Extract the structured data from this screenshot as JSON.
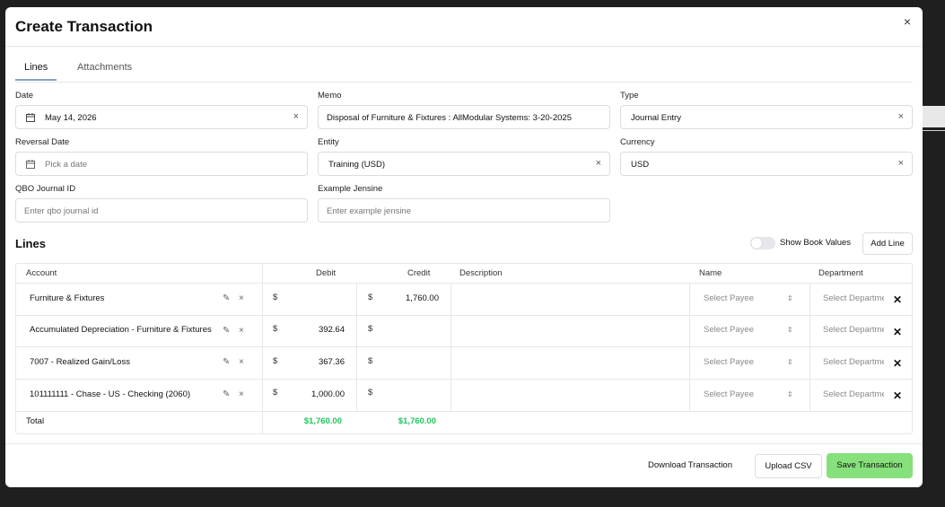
{
  "dialog": {
    "title": "Create Transaction",
    "close_glyph": "×"
  },
  "tabs": [
    {
      "label": "Lines",
      "active": true
    },
    {
      "label": "Attachments",
      "active": false
    }
  ],
  "form": {
    "date": {
      "label": "Date",
      "value": "May 14, 2026"
    },
    "memo": {
      "label": "Memo",
      "value": "Disposal of Furniture & Fixtures : AllModular Systems:  3-20-2025"
    },
    "type": {
      "label": "Type",
      "value": "Journal Entry"
    },
    "reversal_date": {
      "label": "Reversal Date",
      "placeholder": "Pick a date"
    },
    "entity": {
      "label": "Entity",
      "value": "Training (USD)"
    },
    "currency": {
      "label": "Currency",
      "value": "USD"
    },
    "qbo_journal_id": {
      "label": "QBO Journal ID",
      "placeholder": "Enter qbo journal id"
    },
    "example_jensine": {
      "label": "Example Jensine",
      "placeholder": "Enter example jensine"
    }
  },
  "lines_section": {
    "title": "Lines",
    "show_book_values_label": "Show Book Values",
    "show_book_values_on": false,
    "add_line_label": "Add Line"
  },
  "table": {
    "columns": {
      "account": "Account",
      "debit": "Debit",
      "credit": "Credit",
      "description": "Description",
      "name": "Name",
      "department": "Department"
    },
    "currency_symbol": "$",
    "rows": [
      {
        "account": "Furniture & Fixtures",
        "debit": "",
        "credit": "1,760.00",
        "description": "",
        "name_placeholder": "Select Payee",
        "department_placeholder": "Select Department"
      },
      {
        "account": "Accumulated Depreciation - Furniture & Fixtures",
        "debit": "392.64",
        "credit": "",
        "description": "",
        "name_placeholder": "Select Payee",
        "department_placeholder": "Select Department"
      },
      {
        "account": "7007 - Realized Gain/Loss",
        "debit": "367.36",
        "credit": "",
        "description": "",
        "name_placeholder": "Select Payee",
        "department_placeholder": "Select Department"
      },
      {
        "account": "101111111 - Chase - US - Checking (2060)",
        "debit": "1,000.00",
        "credit": "",
        "description": "",
        "name_placeholder": "Select Payee",
        "department_placeholder": "Select Department"
      }
    ],
    "total": {
      "label": "Total",
      "debit": "$1,760.00",
      "credit": "$1,760.00"
    }
  },
  "footer": {
    "download_label": "Download Transaction",
    "upload_label": "Upload CSV",
    "save_label": "Save Transaction"
  },
  "colors": {
    "total_green": "#22c55e",
    "save_button": "#86e07b",
    "tab_underline": "#8aa0c8"
  }
}
